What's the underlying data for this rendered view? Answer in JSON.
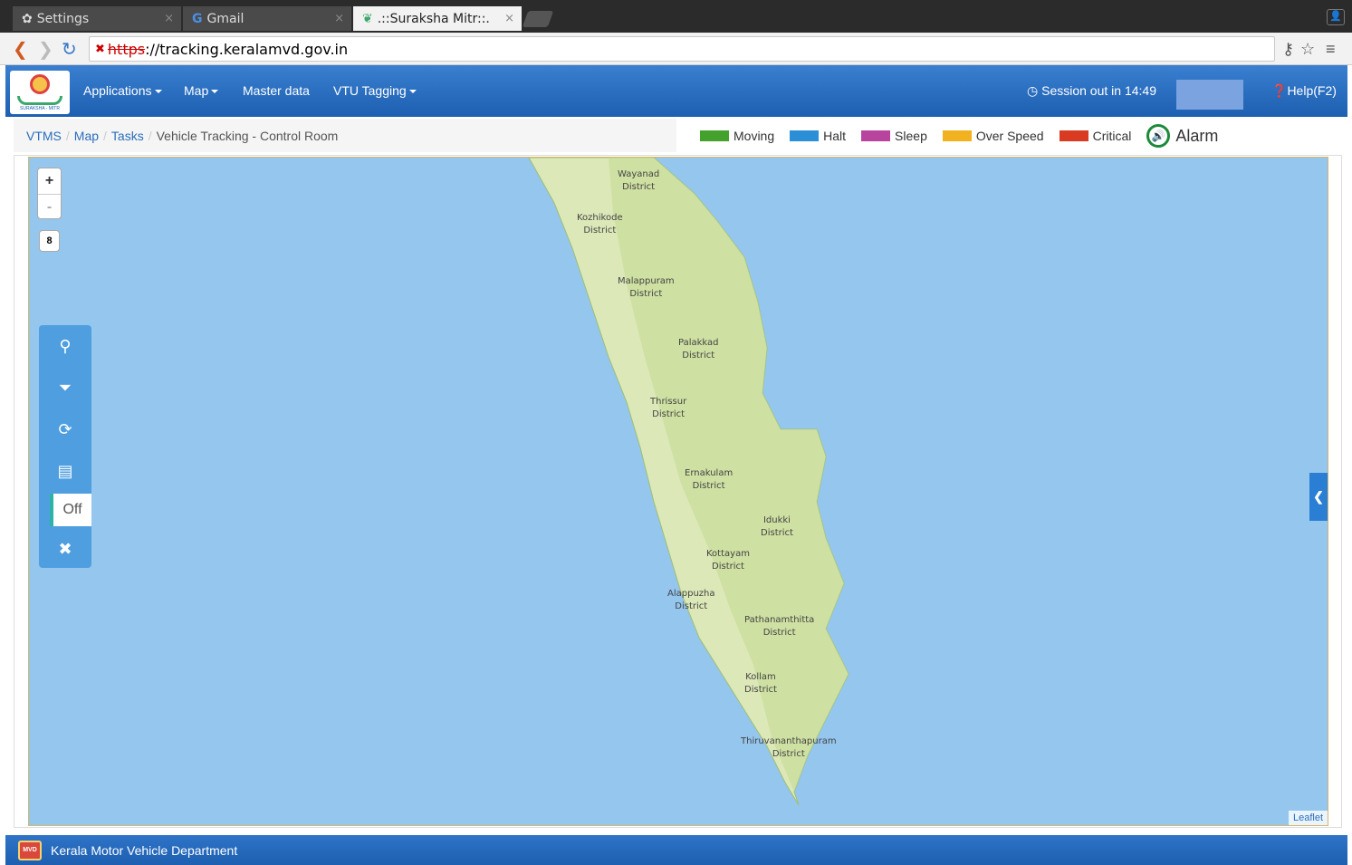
{
  "browser": {
    "tabs": [
      {
        "label": "Settings",
        "icon": "gear-icon"
      },
      {
        "label": "Gmail",
        "icon": "google-icon"
      },
      {
        "label": ".::Suraksha Mitr::.",
        "icon": "suraksha-icon"
      }
    ],
    "url_scheme": "https",
    "url_rest": "://tracking.keralamvd.gov.in"
  },
  "header": {
    "logo_text": "SURAKSHA - MITR",
    "menu": [
      {
        "label": "Applications",
        "dropdown": true
      },
      {
        "label": "Map",
        "dropdown": true
      },
      {
        "label": "Master data",
        "dropdown": false
      },
      {
        "label": "VTU Tagging",
        "dropdown": true
      }
    ],
    "session": "Session out in 14:49",
    "help": "Help(F2)"
  },
  "breadcrumb": [
    "VTMS",
    "Map",
    "Tasks",
    "Vehicle Tracking - Control Room"
  ],
  "legend": [
    {
      "label": "Moving",
      "color": "#44a12b"
    },
    {
      "label": "Halt",
      "color": "#2a8fd6"
    },
    {
      "label": "Sleep",
      "color": "#b8449e"
    },
    {
      "label": "Over Speed",
      "color": "#f2b21f"
    },
    {
      "label": "Critical",
      "color": "#d83a22"
    }
  ],
  "alarm_label": "Alarm",
  "map": {
    "zoom_in": "+",
    "zoom_out": "-",
    "zoom_level": "8",
    "toggle_label": "Off",
    "attribution": "Leaflet",
    "districts": [
      {
        "name": "Wayanad",
        "sub": "District"
      },
      {
        "name": "Kozhikode",
        "sub": "District"
      },
      {
        "name": "Malappuram",
        "sub": "District"
      },
      {
        "name": "Palakkad",
        "sub": "District"
      },
      {
        "name": "Thrissur",
        "sub": "District"
      },
      {
        "name": "Ernakulam",
        "sub": "District"
      },
      {
        "name": "Idukki",
        "sub": "District"
      },
      {
        "name": "Kottayam",
        "sub": "District"
      },
      {
        "name": "Alappuzha",
        "sub": "District"
      },
      {
        "name": "Pathanamthitta",
        "sub": "District"
      },
      {
        "name": "Kollam",
        "sub": "District"
      },
      {
        "name": "Thiruvananthapuram",
        "sub": "District"
      }
    ]
  },
  "footer": {
    "title": "Kerala Motor Vehicle Department",
    "logo_text": "MVD"
  }
}
